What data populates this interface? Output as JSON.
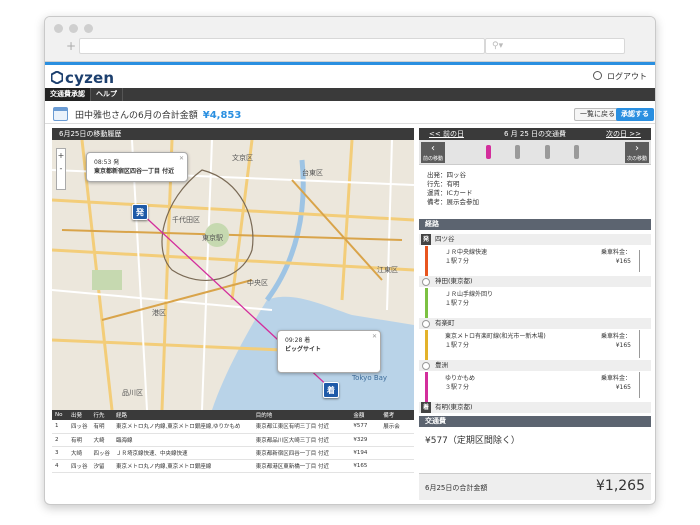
{
  "browser": {
    "new_tab": "+"
  },
  "app": {
    "logo": "cyzen",
    "logout": "ログアウト"
  },
  "menu": [
    {
      "label": "交通費承認"
    },
    {
      "label": "ヘルプ"
    }
  ],
  "header": {
    "title": "田中雅也さんの6月の合計金額",
    "amount": "¥4,853",
    "btn_list": "一覧に戻る",
    "btn_approve": "承認する"
  },
  "map_panel": {
    "title": "6月25日の移動履歴",
    "ctl_plus": "+",
    "ctl_minus": "-",
    "callout_start": {
      "time": "08:53 発",
      "place": "東京都新宿区四谷一丁目 付近"
    },
    "callout_end": {
      "time": "09:28 着",
      "place": "ビッグサイト"
    },
    "pin_start": "発",
    "pin_end": "着",
    "map_labels": [
      "文京区",
      "台東区",
      "千代田区",
      "東京駅",
      "中央区",
      "江東区",
      "港区",
      "品川区",
      "Tokyo Bay"
    ]
  },
  "table": {
    "headers": [
      "No",
      "出発",
      "行先",
      "経路",
      "目的地",
      "金額",
      "備考"
    ],
    "rows": [
      [
        "1",
        "四ッ谷",
        "有明",
        "東京メトロ丸ノ内線,東京メトロ銀座線,ゆりかもめ",
        "東京都江東区有明三丁目 付近",
        "¥577",
        "展示会"
      ],
      [
        "2",
        "有明",
        "大崎",
        "臨海線",
        "東京都品川区大崎三丁目 付近",
        "¥329",
        ""
      ],
      [
        "3",
        "大崎",
        "四ッ谷",
        "ＪＲ埼京線快速、中央線快速",
        "東京都新宿区四谷一丁目 付近",
        "¥194",
        ""
      ],
      [
        "4",
        "四ッ谷",
        "汐留",
        "東京メトロ丸ノ内線,東京メトロ銀座線",
        "東京都港区東新橋一丁目 付近",
        "¥165",
        ""
      ]
    ]
  },
  "right_panel": {
    "prev": "<< 前の日",
    "title": "6 月 25 日の交通費",
    "next": "次の日 >>",
    "prev_move": "前の移動",
    "next_move": "次の移動",
    "info": [
      "出発：四ッ谷",
      "行先：有明",
      "運賃：ICカード",
      "備考：展示会参加"
    ],
    "route_header": "経路",
    "stations": [
      "四ツ谷",
      "神田(東京都)",
      "有楽町",
      "豊洲",
      "有明(東京都)"
    ],
    "segments": [
      {
        "line": "ＪＲ中央線快速",
        "stops": "１駅７分",
        "fare_label": "乗車料金：",
        "fare": "¥165",
        "color": "#e8551f"
      },
      {
        "line": "ＪＲ山手線外回り",
        "stops": "１駅７分",
        "fare_label": "",
        "fare": "",
        "color": "#7cc142"
      },
      {
        "line": "東京メトロ有楽町線(和光市ー新木場)",
        "stops": "１駅７分",
        "fare_label": "乗車料金：",
        "fare": "¥165",
        "color": "#e3b22a"
      },
      {
        "line": "ゆりかもめ",
        "stops": "３駅７分",
        "fare_label": "乗車料金：",
        "fare": "¥165",
        "color": "#d32e9c"
      }
    ],
    "start_badge": "発",
    "end_badge": "着",
    "fee_header": "交通費",
    "fee": "¥577（定期区間除く）",
    "total_label": "6月25日の合計金額",
    "total": "¥1,265"
  },
  "colors": {
    "accent": "#2a8fe0",
    "dark": "#3a3a3a",
    "route_line": "#d32e9c",
    "pin": "#1e5aa8"
  }
}
